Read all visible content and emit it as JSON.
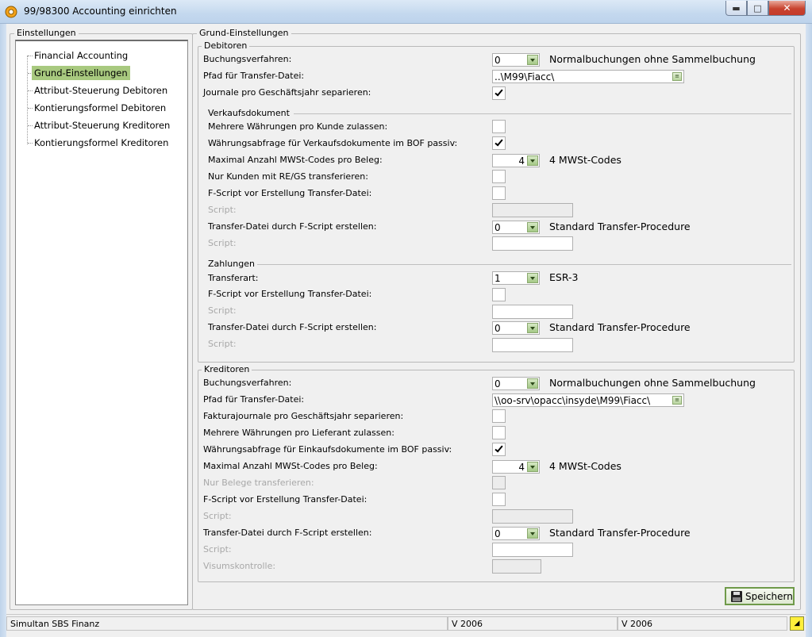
{
  "window": {
    "title": "99/98300 Accounting einrichten",
    "icons": {
      "app": "gear-icon",
      "min": "minimize-icon",
      "max": "maximize-icon",
      "close": "close-icon"
    },
    "min_glyph": "▬",
    "max_glyph": "□",
    "close_glyph": "✕"
  },
  "left_panel": {
    "title": "Einstellungen",
    "items": [
      {
        "label": "Financial Accounting",
        "selected": false
      },
      {
        "label": "Grund-Einstellungen",
        "selected": true
      },
      {
        "label": "Attribut-Steuerung Debitoren",
        "selected": false
      },
      {
        "label": "Kontierungsformel Debitoren",
        "selected": false
      },
      {
        "label": "Attribut-Steuerung Kreditoren",
        "selected": false
      },
      {
        "label": "Kontierungsformel Kreditoren",
        "selected": false
      }
    ]
  },
  "main": {
    "title": "Grund-Einstellungen",
    "debitoren": {
      "title": "Debitoren",
      "buchungsverfahren_label": "Buchungsverfahren:",
      "buchungsverfahren_value": "0",
      "buchungsverfahren_desc": "Normalbuchungen ohne Sammelbuchung",
      "pfad_label": "Pfad für Transfer-Datei:",
      "pfad_value": "..\\M99\\Fiacc\\",
      "journale_label": "Journale pro Geschäftsjahr separieren:",
      "journale_checked": true,
      "verkaufsdokument": {
        "title": "Verkaufsdokument",
        "mehrere_label": "Mehrere Währungen pro Kunde zulassen:",
        "mehrere_checked": false,
        "abfrage_label": "Währungsabfrage für Verkaufsdokumente im BOF passiv:",
        "abfrage_checked": true,
        "mwst_label": "Maximal Anzahl MWSt-Codes pro Beleg:",
        "mwst_value": "4",
        "mwst_desc": "4 MWSt-Codes",
        "nur_kunden_label": "Nur Kunden mit RE/GS transferieren:",
        "nur_kunden_checked": false,
        "fscript_vor_label": "F-Script vor Erstellung Transfer-Datei:",
        "fscript_vor_checked": false,
        "script1_label": "Script:",
        "transfer_label": "Transfer-Datei durch F-Script erstellen:",
        "transfer_value": "0",
        "transfer_desc": "Standard Transfer-Procedure",
        "script2_label": "Script:"
      },
      "zahlungen": {
        "title": "Zahlungen",
        "transferart_label": "Transferart:",
        "transferart_value": "1",
        "transferart_desc": "ESR-3",
        "fscript_vor_label": "F-Script vor Erstellung Transfer-Datei:",
        "fscript_vor_checked": false,
        "script1_label": "Script:",
        "transfer_label": "Transfer-Datei durch F-Script erstellen:",
        "transfer_value": "0",
        "transfer_desc": "Standard Transfer-Procedure",
        "script2_label": "Script:"
      }
    },
    "kreditoren": {
      "title": "Kreditoren",
      "buchungsverfahren_label": "Buchungsverfahren:",
      "buchungsverfahren_value": "0",
      "buchungsverfahren_desc": "Normalbuchungen ohne Sammelbuchung",
      "pfad_label": "Pfad für Transfer-Datei:",
      "pfad_value": "\\\\oo-srv\\opacc\\insyde\\M99\\Fiacc\\",
      "faktura_label": "Fakturajournale pro Geschäftsjahr separieren:",
      "faktura_checked": false,
      "mehrere_label": "Mehrere Währungen pro Lieferant zulassen:",
      "mehrere_checked": false,
      "abfrage_label": "Währungsabfrage für Einkaufsdokumente im BOF passiv:",
      "abfrage_checked": true,
      "mwst_label": "Maximal Anzahl MWSt-Codes pro Beleg:",
      "mwst_value": "4",
      "mwst_desc": "4 MWSt-Codes",
      "nur_belege_label": "Nur Belege transferieren:",
      "fscript_vor_label": "F-Script vor Erstellung Transfer-Datei:",
      "fscript_vor_checked": false,
      "script1_label": "Script:",
      "transfer_label": "Transfer-Datei durch F-Script erstellen:",
      "transfer_value": "0",
      "transfer_desc": "Standard Transfer-Procedure",
      "script2_label": "Script:",
      "visum_label": "Visumskontrolle:"
    },
    "save_label": "Speichern",
    "save_icon": "floppy-disk-icon"
  },
  "status_bar": {
    "app": "Simultan SBS Finanz",
    "version1": "V 2006",
    "version2": "V 2006",
    "corner_icon": "resize-grip-icon"
  },
  "colors": {
    "selection": "#a8c97f",
    "accent_green": "#8aa86e",
    "close_red": "#c8432f"
  }
}
